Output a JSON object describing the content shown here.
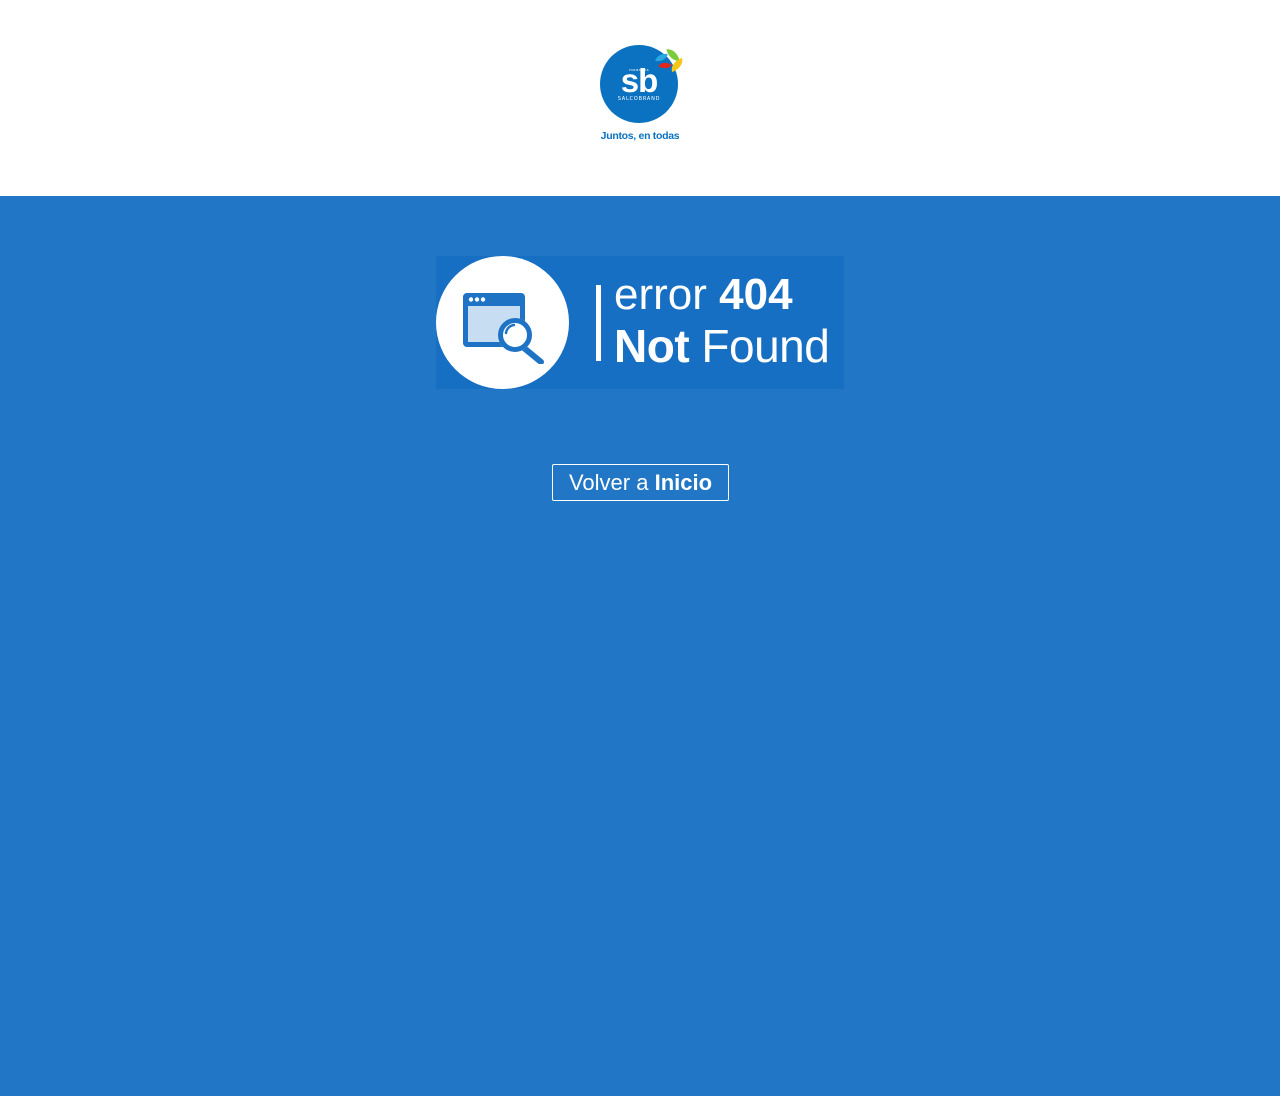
{
  "header": {
    "logo": {
      "top_text": "FARMACIAS",
      "mark": "sb",
      "brand": "SALCOBRAND",
      "tagline": "Juntos, en todas",
      "colors": {
        "circle": "#0a72c0",
        "leaf_green": "#7ccb3f",
        "leaf_yellow": "#f6c717",
        "leaf_red": "#e0261d",
        "leaf_blue": "#2aa6e2"
      }
    }
  },
  "main": {
    "background_color": "#2177c6",
    "error": {
      "icon": "browser-search-icon",
      "line1_light": "error",
      "line1_bold": "404",
      "line2_bold": "Not",
      "line2_light": "Found"
    },
    "home_button": {
      "light": "Volver a",
      "bold": "Inicio"
    }
  }
}
